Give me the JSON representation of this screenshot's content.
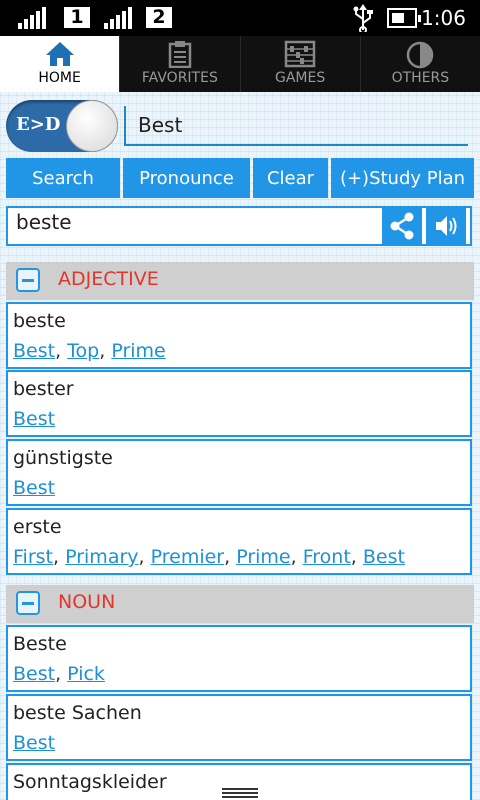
{
  "status_bar": {
    "sim1": "1",
    "sim2": "2",
    "time": "1:06",
    "icons": [
      "signal-icon",
      "usb-icon",
      "battery-icon"
    ]
  },
  "tabs": [
    {
      "label": "HOME",
      "icon": "home-icon",
      "active": true
    },
    {
      "label": "FAVORITES",
      "icon": "clipboard-icon",
      "active": false
    },
    {
      "label": "GAMES",
      "icon": "abacus-icon",
      "active": false
    },
    {
      "label": "OTHERS",
      "icon": "pie-icon",
      "active": false
    }
  ],
  "direction_toggle": {
    "label": "E>D"
  },
  "search": {
    "value": "Best"
  },
  "actions": {
    "search": "Search",
    "pronounce": "Pronounce",
    "clear": "Clear",
    "study_plan": "(+)Study Plan"
  },
  "result": {
    "word": "beste"
  },
  "sections": [
    {
      "title": "ADJECTIVE",
      "entries": [
        {
          "word": "beste",
          "translations": [
            "Best",
            "Top",
            "Prime"
          ]
        },
        {
          "word": "bester",
          "translations": [
            "Best"
          ]
        },
        {
          "word": "günstigste",
          "translations": [
            "Best"
          ]
        },
        {
          "word": "erste",
          "translations": [
            "First",
            "Primary",
            "Premier",
            "Prime",
            "Front",
            "Best"
          ]
        }
      ]
    },
    {
      "title": "NOUN",
      "entries": [
        {
          "word": "Beste",
          "translations": [
            "Best",
            "Pick"
          ]
        },
        {
          "word": "beste Sachen",
          "translations": [
            "Best"
          ]
        },
        {
          "word": "Sonntagskleider",
          "translations": []
        }
      ]
    }
  ],
  "colors": {
    "accent": "#2196e6",
    "section_title": "#e4342c",
    "link": "#1e90d8"
  }
}
